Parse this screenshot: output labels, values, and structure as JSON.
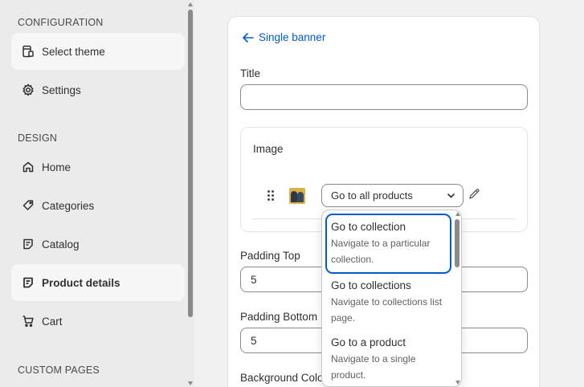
{
  "sidebar": {
    "sections": {
      "configuration": "CONFIGURATION",
      "design": "DESIGN",
      "custom_pages": "CUSTOM PAGES"
    },
    "items": {
      "select_theme": "Select theme",
      "settings": "Settings",
      "home": "Home",
      "categories": "Categories",
      "catalog": "Catalog",
      "product_details": "Product details",
      "cart": "Cart"
    }
  },
  "panel": {
    "back_label": "Single banner",
    "title_label": "Title",
    "title_value": "",
    "image_label": "Image",
    "link_select_value": "Go to all products",
    "padding_top_label": "Padding Top",
    "padding_top_value": "5",
    "padding_bottom_label": "Padding Bottom",
    "padding_bottom_value": "5",
    "background_color_label": "Background Color"
  },
  "dropdown": {
    "options": [
      {
        "title": "Go to collection",
        "desc_line1": "Navigate to a particular",
        "desc_line2": "collection."
      },
      {
        "title": "Go to collections",
        "desc_line1": "Navigate to collections list",
        "desc_line2": "page."
      },
      {
        "title": "Go to a product",
        "desc_line1": "Navigate to a single",
        "desc_line2": "product."
      }
    ]
  },
  "colors": {
    "accent": "#005bd3",
    "sidebar_bg": "#ebebeb",
    "page_bg": "#f1f1f1"
  }
}
